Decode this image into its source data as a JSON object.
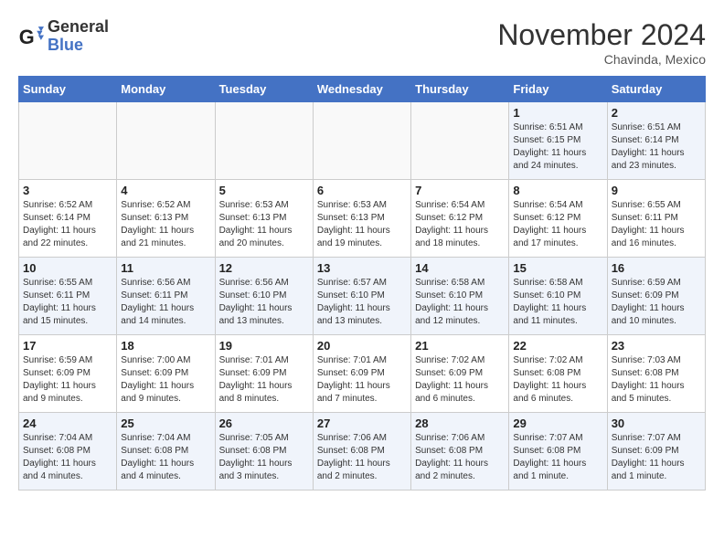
{
  "header": {
    "logo_general": "General",
    "logo_blue": "Blue",
    "month": "November 2024",
    "location": "Chavinda, Mexico"
  },
  "weekdays": [
    "Sunday",
    "Monday",
    "Tuesday",
    "Wednesday",
    "Thursday",
    "Friday",
    "Saturday"
  ],
  "weeks": [
    [
      {
        "day": "",
        "info": ""
      },
      {
        "day": "",
        "info": ""
      },
      {
        "day": "",
        "info": ""
      },
      {
        "day": "",
        "info": ""
      },
      {
        "day": "",
        "info": ""
      },
      {
        "day": "1",
        "info": "Sunrise: 6:51 AM\nSunset: 6:15 PM\nDaylight: 11 hours and 24 minutes."
      },
      {
        "day": "2",
        "info": "Sunrise: 6:51 AM\nSunset: 6:14 PM\nDaylight: 11 hours and 23 minutes."
      }
    ],
    [
      {
        "day": "3",
        "info": "Sunrise: 6:52 AM\nSunset: 6:14 PM\nDaylight: 11 hours and 22 minutes."
      },
      {
        "day": "4",
        "info": "Sunrise: 6:52 AM\nSunset: 6:13 PM\nDaylight: 11 hours and 21 minutes."
      },
      {
        "day": "5",
        "info": "Sunrise: 6:53 AM\nSunset: 6:13 PM\nDaylight: 11 hours and 20 minutes."
      },
      {
        "day": "6",
        "info": "Sunrise: 6:53 AM\nSunset: 6:13 PM\nDaylight: 11 hours and 19 minutes."
      },
      {
        "day": "7",
        "info": "Sunrise: 6:54 AM\nSunset: 6:12 PM\nDaylight: 11 hours and 18 minutes."
      },
      {
        "day": "8",
        "info": "Sunrise: 6:54 AM\nSunset: 6:12 PM\nDaylight: 11 hours and 17 minutes."
      },
      {
        "day": "9",
        "info": "Sunrise: 6:55 AM\nSunset: 6:11 PM\nDaylight: 11 hours and 16 minutes."
      }
    ],
    [
      {
        "day": "10",
        "info": "Sunrise: 6:55 AM\nSunset: 6:11 PM\nDaylight: 11 hours and 15 minutes."
      },
      {
        "day": "11",
        "info": "Sunrise: 6:56 AM\nSunset: 6:11 PM\nDaylight: 11 hours and 14 minutes."
      },
      {
        "day": "12",
        "info": "Sunrise: 6:56 AM\nSunset: 6:10 PM\nDaylight: 11 hours and 13 minutes."
      },
      {
        "day": "13",
        "info": "Sunrise: 6:57 AM\nSunset: 6:10 PM\nDaylight: 11 hours and 13 minutes."
      },
      {
        "day": "14",
        "info": "Sunrise: 6:58 AM\nSunset: 6:10 PM\nDaylight: 11 hours and 12 minutes."
      },
      {
        "day": "15",
        "info": "Sunrise: 6:58 AM\nSunset: 6:10 PM\nDaylight: 11 hours and 11 minutes."
      },
      {
        "day": "16",
        "info": "Sunrise: 6:59 AM\nSunset: 6:09 PM\nDaylight: 11 hours and 10 minutes."
      }
    ],
    [
      {
        "day": "17",
        "info": "Sunrise: 6:59 AM\nSunset: 6:09 PM\nDaylight: 11 hours and 9 minutes."
      },
      {
        "day": "18",
        "info": "Sunrise: 7:00 AM\nSunset: 6:09 PM\nDaylight: 11 hours and 9 minutes."
      },
      {
        "day": "19",
        "info": "Sunrise: 7:01 AM\nSunset: 6:09 PM\nDaylight: 11 hours and 8 minutes."
      },
      {
        "day": "20",
        "info": "Sunrise: 7:01 AM\nSunset: 6:09 PM\nDaylight: 11 hours and 7 minutes."
      },
      {
        "day": "21",
        "info": "Sunrise: 7:02 AM\nSunset: 6:09 PM\nDaylight: 11 hours and 6 minutes."
      },
      {
        "day": "22",
        "info": "Sunrise: 7:02 AM\nSunset: 6:08 PM\nDaylight: 11 hours and 6 minutes."
      },
      {
        "day": "23",
        "info": "Sunrise: 7:03 AM\nSunset: 6:08 PM\nDaylight: 11 hours and 5 minutes."
      }
    ],
    [
      {
        "day": "24",
        "info": "Sunrise: 7:04 AM\nSunset: 6:08 PM\nDaylight: 11 hours and 4 minutes."
      },
      {
        "day": "25",
        "info": "Sunrise: 7:04 AM\nSunset: 6:08 PM\nDaylight: 11 hours and 4 minutes."
      },
      {
        "day": "26",
        "info": "Sunrise: 7:05 AM\nSunset: 6:08 PM\nDaylight: 11 hours and 3 minutes."
      },
      {
        "day": "27",
        "info": "Sunrise: 7:06 AM\nSunset: 6:08 PM\nDaylight: 11 hours and 2 minutes."
      },
      {
        "day": "28",
        "info": "Sunrise: 7:06 AM\nSunset: 6:08 PM\nDaylight: 11 hours and 2 minutes."
      },
      {
        "day": "29",
        "info": "Sunrise: 7:07 AM\nSunset: 6:08 PM\nDaylight: 11 hours and 1 minute."
      },
      {
        "day": "30",
        "info": "Sunrise: 7:07 AM\nSunset: 6:09 PM\nDaylight: 11 hours and 1 minute."
      }
    ]
  ]
}
